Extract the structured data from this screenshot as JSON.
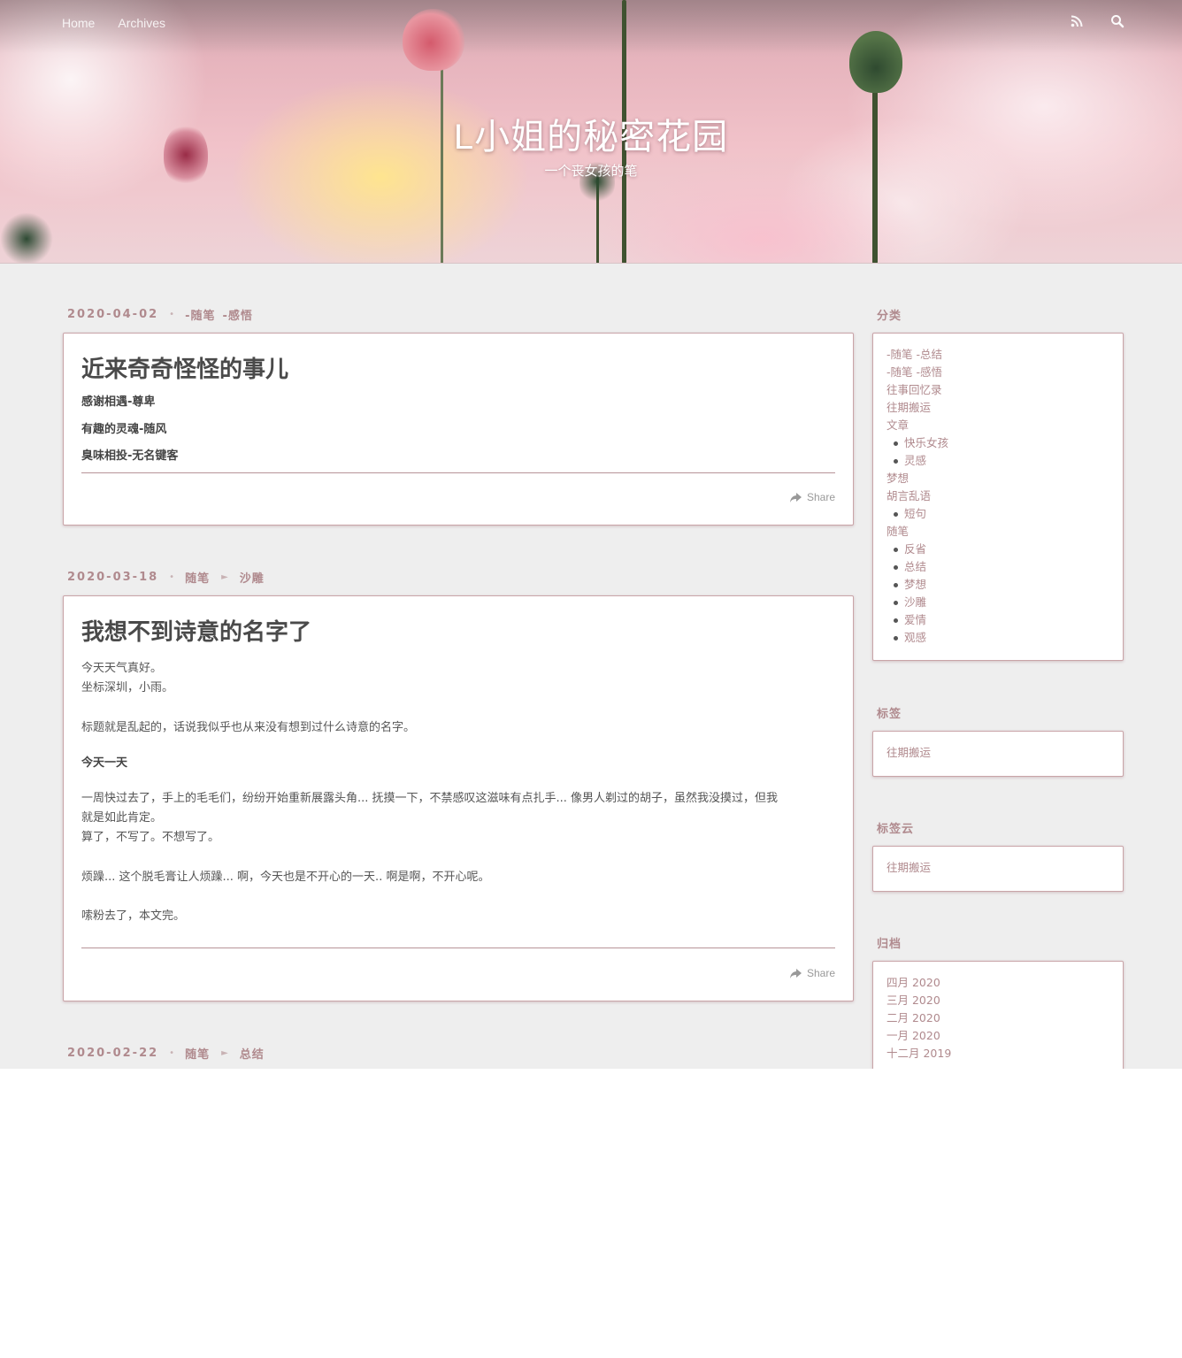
{
  "nav": {
    "home_label": "Home",
    "archives_label": "Archives",
    "rss_icon": "rss-icon",
    "search_icon": "search-icon"
  },
  "site": {
    "title": "L小姐的秘密花园",
    "subtitle": "一个丧女孩的笔"
  },
  "posts": [
    {
      "date": "2020-04-02",
      "categories": [
        "-随笔",
        "-感悟"
      ],
      "title": "近来奇奇怪怪的事儿",
      "lines": [
        "感谢相遇-尊卑",
        "有趣的灵魂-随风",
        "臭味相投-无名键客"
      ],
      "share_label": "Share"
    },
    {
      "date": "2020-03-18",
      "categories": [
        "随笔",
        "沙雕"
      ],
      "title": "我想不到诗意的名字了",
      "lines": [
        "今天天气真好。",
        "坐标深圳，小雨。",
        "标题就是乱起的，话说我似乎也从来没有想到过什么诗意的名字。",
        "今天一天",
        "一周快过去了，手上的毛毛们，纷纷开始重新展露头角... 抚摸一下，不禁感叹这滋味有点扎手... 像男人剃过的胡子，虽然我没摸过，但我",
        "就是如此肯定。",
        "算了，不写了。不想写了。",
        "烦躁... 这个脱毛膏让人烦躁... 啊，今天也是不开心的一天.. 啊是啊，不开心呢。",
        "嗦粉去了，本文完。"
      ],
      "share_label": "Share"
    },
    {
      "date": "2020-02-22",
      "categories": [
        "随笔",
        "总结"
      ]
    }
  ],
  "sidebar": {
    "categories": {
      "title": "分类",
      "items": [
        {
          "label": "-随笔 -总结",
          "level": 0
        },
        {
          "label": "-随笔 -感悟",
          "level": 0
        },
        {
          "label": "往事回忆录",
          "level": 0
        },
        {
          "label": "往期搬运",
          "level": 0
        },
        {
          "label": "文章",
          "level": 0
        },
        {
          "label": "快乐女孩",
          "level": 1
        },
        {
          "label": "灵感",
          "level": 1
        },
        {
          "label": "梦想",
          "level": 0
        },
        {
          "label": "胡言乱语",
          "level": 0
        },
        {
          "label": "短句",
          "level": 1
        },
        {
          "label": "随笔",
          "level": 0
        },
        {
          "label": "反省",
          "level": 1
        },
        {
          "label": "总结",
          "level": 1
        },
        {
          "label": "梦想",
          "level": 1
        },
        {
          "label": "沙雕",
          "level": 1
        },
        {
          "label": "爱情",
          "level": 1
        },
        {
          "label": "观感",
          "level": 1
        }
      ]
    },
    "tags": {
      "title": "标签",
      "items": [
        "往期搬运"
      ]
    },
    "tag_cloud": {
      "title": "标签云",
      "items": [
        "往期搬运"
      ]
    },
    "archives": {
      "title": "归档",
      "items": [
        "四月 2020",
        "三月 2020",
        "二月 2020",
        "一月 2020",
        "十二月 2019"
      ]
    }
  },
  "colors": {
    "accent": "#b08a8e",
    "card_border": "#c9a4a8",
    "page_bg": "#eeeeee"
  }
}
